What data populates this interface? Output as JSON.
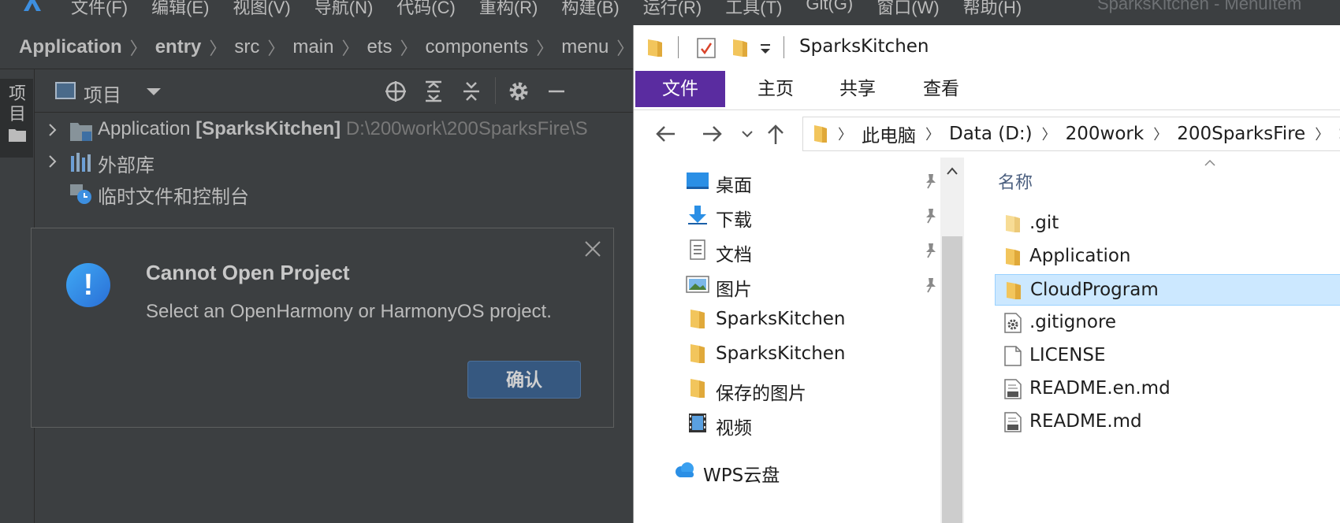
{
  "ide": {
    "menu": [
      "文件(F)",
      "编辑(E)",
      "视图(V)",
      "导航(N)",
      "代码(C)",
      "重构(R)",
      "构建(B)",
      "运行(R)",
      "工具(T)",
      "Git(G)",
      "窗口(W)",
      "帮助(H)"
    ],
    "window_title": "SparksKitchen - MenuItem",
    "breadcrumb": [
      "Application",
      "entry",
      "src",
      "main",
      "ets",
      "components",
      "menu"
    ],
    "breadcrumb_file_icon": "ETS",
    "side_tab_label": "项目",
    "project_panel": {
      "view_label": "项目"
    },
    "tree": [
      {
        "name": "Application",
        "bracket": "[SparksKitchen]",
        "path": "D:\\200work\\200SparksFire\\S"
      },
      {
        "name": "外部库"
      },
      {
        "name": "临时文件和控制台"
      }
    ],
    "dialog": {
      "icon": "!",
      "title": "Cannot Open Project",
      "message": "Select an OpenHarmony or HarmonyOS project.",
      "confirm": "确认"
    }
  },
  "explorer": {
    "title": "SparksKitchen",
    "ribbon": [
      "文件",
      "主页",
      "共享",
      "查看"
    ],
    "address": [
      "此电脑",
      "Data (D:)",
      "200work",
      "200SparksFire",
      "Sp"
    ],
    "nav": [
      {
        "label": "桌面",
        "icon": "desktop-icon",
        "pinned": true
      },
      {
        "label": "下载",
        "icon": "download-icon",
        "pinned": true
      },
      {
        "label": "文档",
        "icon": "document-icon",
        "pinned": true
      },
      {
        "label": "图片",
        "icon": "pictures-icon",
        "pinned": true
      },
      {
        "label": "SparksKitchen",
        "icon": "folder-icon",
        "pinned": false
      },
      {
        "label": "SparksKitchen",
        "icon": "folder-icon",
        "pinned": false
      },
      {
        "label": "保存的图片",
        "icon": "folder-icon",
        "pinned": false
      },
      {
        "label": "视频",
        "icon": "video-icon",
        "pinned": false
      },
      {
        "label": "WPS云盘",
        "icon": "cloud-icon",
        "pinned": false
      }
    ],
    "column_name": "名称",
    "files": [
      {
        "label": ".git",
        "type": "folder-pale"
      },
      {
        "label": "Application",
        "type": "folder"
      },
      {
        "label": "CloudProgram",
        "type": "folder",
        "selected": true
      },
      {
        "label": ".gitignore",
        "type": "settings-file"
      },
      {
        "label": "LICENSE",
        "type": "blank-file"
      },
      {
        "label": "README.en.md",
        "type": "md-file"
      },
      {
        "label": "README.md",
        "type": "md-file"
      }
    ]
  }
}
